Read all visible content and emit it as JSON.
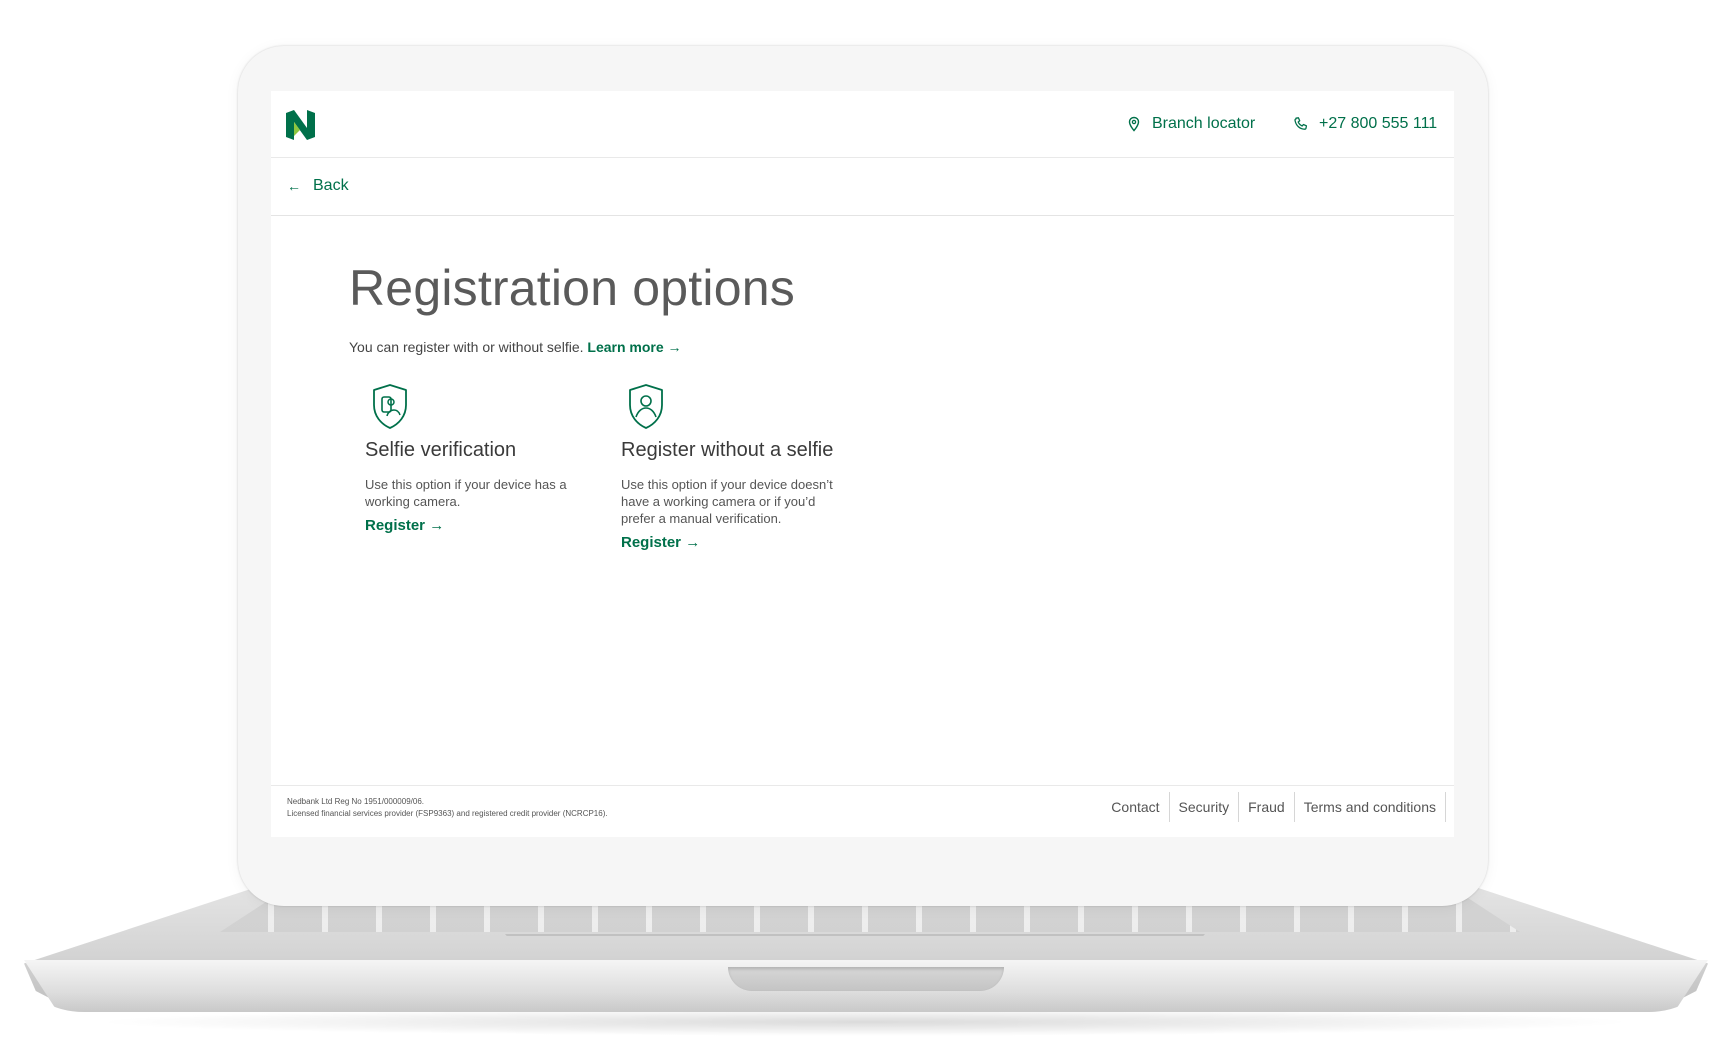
{
  "header": {
    "branch_locator": "Branch locator",
    "phone": "+27 800 555 111"
  },
  "nav": {
    "back_label": "Back"
  },
  "main": {
    "title": "Registration options",
    "intro_text": "You can register with or without selfie.",
    "learn_more": "Learn more →",
    "options": [
      {
        "title": "Selfie verification",
        "description": "Use this option if your device has a working camera.",
        "link": "Register →",
        "icon": "shield-phone-icon"
      },
      {
        "title": "Register without a selfie",
        "description": "Use this option if your device doesn’t have a working camera or if you’d prefer a manual verification.",
        "link": "Register →",
        "icon": "shield-user-icon"
      }
    ]
  },
  "footer": {
    "legal_line1": "Nedbank Ltd Reg No 1951/000009/06.",
    "legal_line2": "Licensed financial services provider (FSP9363) and registered credit provider (NCRCP16).",
    "links": [
      "Contact",
      "Security",
      "Fraud",
      "Terms and conditions"
    ]
  },
  "colors": {
    "brand_green": "#00704a",
    "title_grey": "#5a5a5a",
    "frame": "#f6f6f6"
  }
}
